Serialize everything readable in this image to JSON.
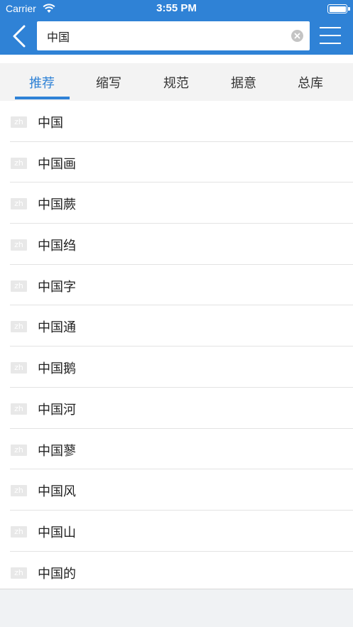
{
  "status_bar": {
    "carrier": "Carrier",
    "time": "3:55 PM"
  },
  "header": {
    "search_value": "中国",
    "back_icon": "chevron-left-icon",
    "menu_icon": "hamburger-menu-icon",
    "clear_icon": "clear-icon"
  },
  "tabs": [
    {
      "label": "推荐",
      "active": true
    },
    {
      "label": "缩写",
      "active": false
    },
    {
      "label": "规范",
      "active": false
    },
    {
      "label": "据意",
      "active": false
    },
    {
      "label": "总库",
      "active": false
    }
  ],
  "results": [
    {
      "badge": "zh",
      "text": "中国"
    },
    {
      "badge": "zh",
      "text": "中国画"
    },
    {
      "badge": "zh",
      "text": "中国蕨"
    },
    {
      "badge": "zh",
      "text": "中国绉"
    },
    {
      "badge": "zh",
      "text": "中国字"
    },
    {
      "badge": "zh",
      "text": "中国通"
    },
    {
      "badge": "zh",
      "text": "中国鹅"
    },
    {
      "badge": "zh",
      "text": "中国河"
    },
    {
      "badge": "zh",
      "text": "中国蓼"
    },
    {
      "badge": "zh",
      "text": "中国风"
    },
    {
      "badge": "zh",
      "text": "中国山"
    },
    {
      "badge": "zh",
      "text": "中国的"
    }
  ],
  "colors": {
    "accent": "#2f82d6",
    "tab_bg": "#f3f3f3",
    "divider": "#e3e3e3"
  }
}
